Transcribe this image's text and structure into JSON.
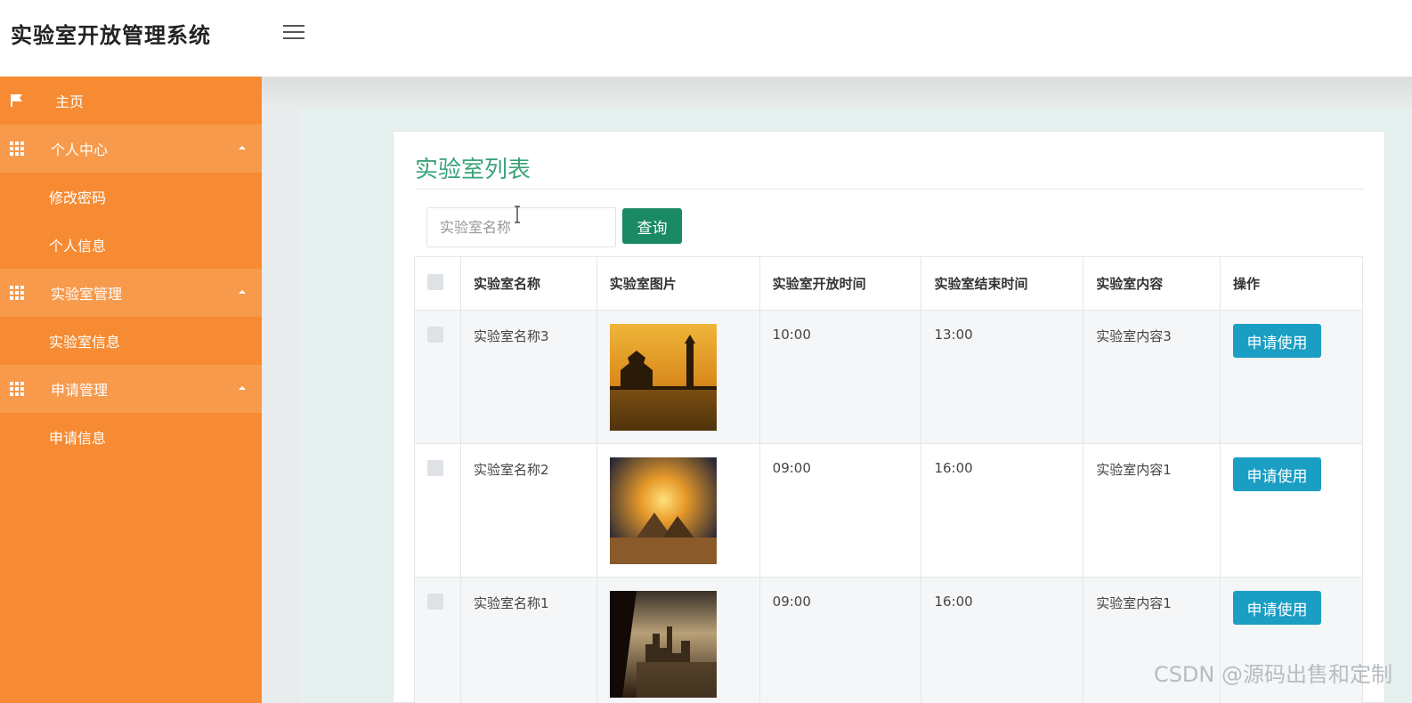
{
  "app": {
    "title": "实验室开放管理系统"
  },
  "sidebar": {
    "home": "主页",
    "groups": [
      {
        "label": "个人中心",
        "items": [
          "修改密码",
          "个人信息"
        ]
      },
      {
        "label": "实验室管理",
        "items": [
          "实验室信息"
        ]
      },
      {
        "label": "申请管理",
        "items": [
          "申请信息"
        ]
      }
    ]
  },
  "page": {
    "title": "实验室列表"
  },
  "search": {
    "placeholder": "实验室名称",
    "button_label": "查询"
  },
  "table": {
    "headers": [
      "实验室名称",
      "实验室图片",
      "实验室开放时间",
      "实验室结束时间",
      "实验室内容",
      "操作"
    ],
    "rows": [
      {
        "name": "实验室名称3",
        "image": "pagoda-sunset-image",
        "open": "10:00",
        "close": "13:00",
        "content": "实验室内容3",
        "action": "申请使用"
      },
      {
        "name": "实验室名称2",
        "image": "pyramids-sunset-image",
        "open": "09:00",
        "close": "16:00",
        "content": "实验室内容1",
        "action": "申请使用"
      },
      {
        "name": "实验室名称1",
        "image": "city-skyline-image",
        "open": "09:00",
        "close": "16:00",
        "content": "实验室内容1",
        "action": "申请使用"
      }
    ]
  },
  "watermark": "CSDN @源码出售和定制",
  "colors": {
    "sidebar": "#f68b33",
    "sidebar_group": "#f79a4c",
    "title_green": "#3aa37a",
    "query_button": "#1a8a63",
    "apply_button": "#1a9ec4"
  }
}
